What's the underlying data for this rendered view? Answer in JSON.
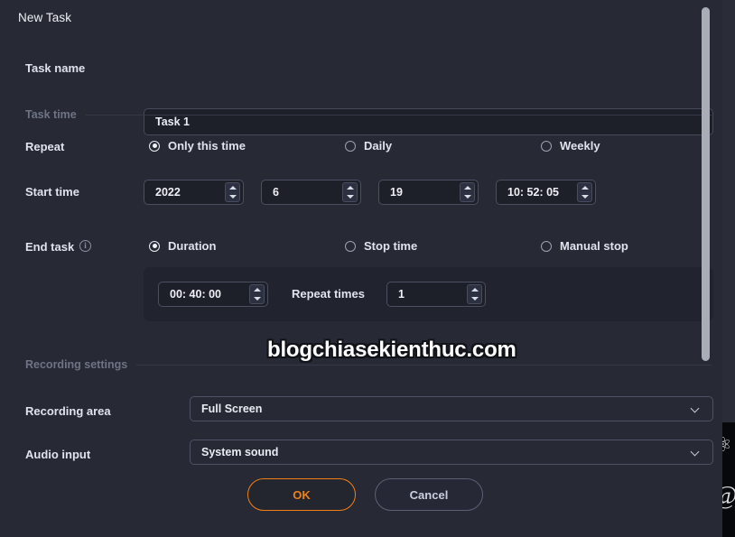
{
  "dialog": {
    "title": "New Task"
  },
  "task_name": {
    "label": "Task name",
    "value": "Task 1",
    "placeholder": "Task name"
  },
  "sections": {
    "task_time": "Task time",
    "recording_settings": "Recording settings"
  },
  "repeat": {
    "label": "Repeat",
    "options": [
      {
        "label": "Only this time",
        "selected": true
      },
      {
        "label": "Daily",
        "selected": false
      },
      {
        "label": "Weekly",
        "selected": false
      }
    ]
  },
  "start_time": {
    "label": "Start time",
    "year": "2022",
    "month": "6",
    "day": "19",
    "time": "10: 52: 05"
  },
  "end_task": {
    "label": "End task",
    "info_icon": "info-icon",
    "info_glyph": "i",
    "options": [
      {
        "label": "Duration",
        "selected": true
      },
      {
        "label": "Stop time",
        "selected": false
      },
      {
        "label": "Manual stop",
        "selected": false
      }
    ],
    "duration_value": "00: 40: 00",
    "repeat_times_label": "Repeat times",
    "repeat_times_value": "1"
  },
  "recording": {
    "area_label": "Recording area",
    "area_value": "Full Screen",
    "audio_label": "Audio input",
    "audio_value": "System sound",
    "chevron_icon": "chevron-down-icon"
  },
  "footer": {
    "ok_label": "OK",
    "cancel_label": "Cancel"
  },
  "watermark": {
    "text": "blogchiasekienthuc.com"
  },
  "colors": {
    "dialog_bg": "#272a35",
    "field_bg": "#1e2029",
    "panel_bg": "#21242e",
    "accent": "#f08016",
    "text": "#e9ecf3",
    "muted": "#6e7385",
    "border": "#4a4f61",
    "scrollbar": "#a9adb6"
  },
  "spinner": {
    "up_icon": "triangle-up-icon",
    "down_icon": "triangle-down-icon"
  }
}
